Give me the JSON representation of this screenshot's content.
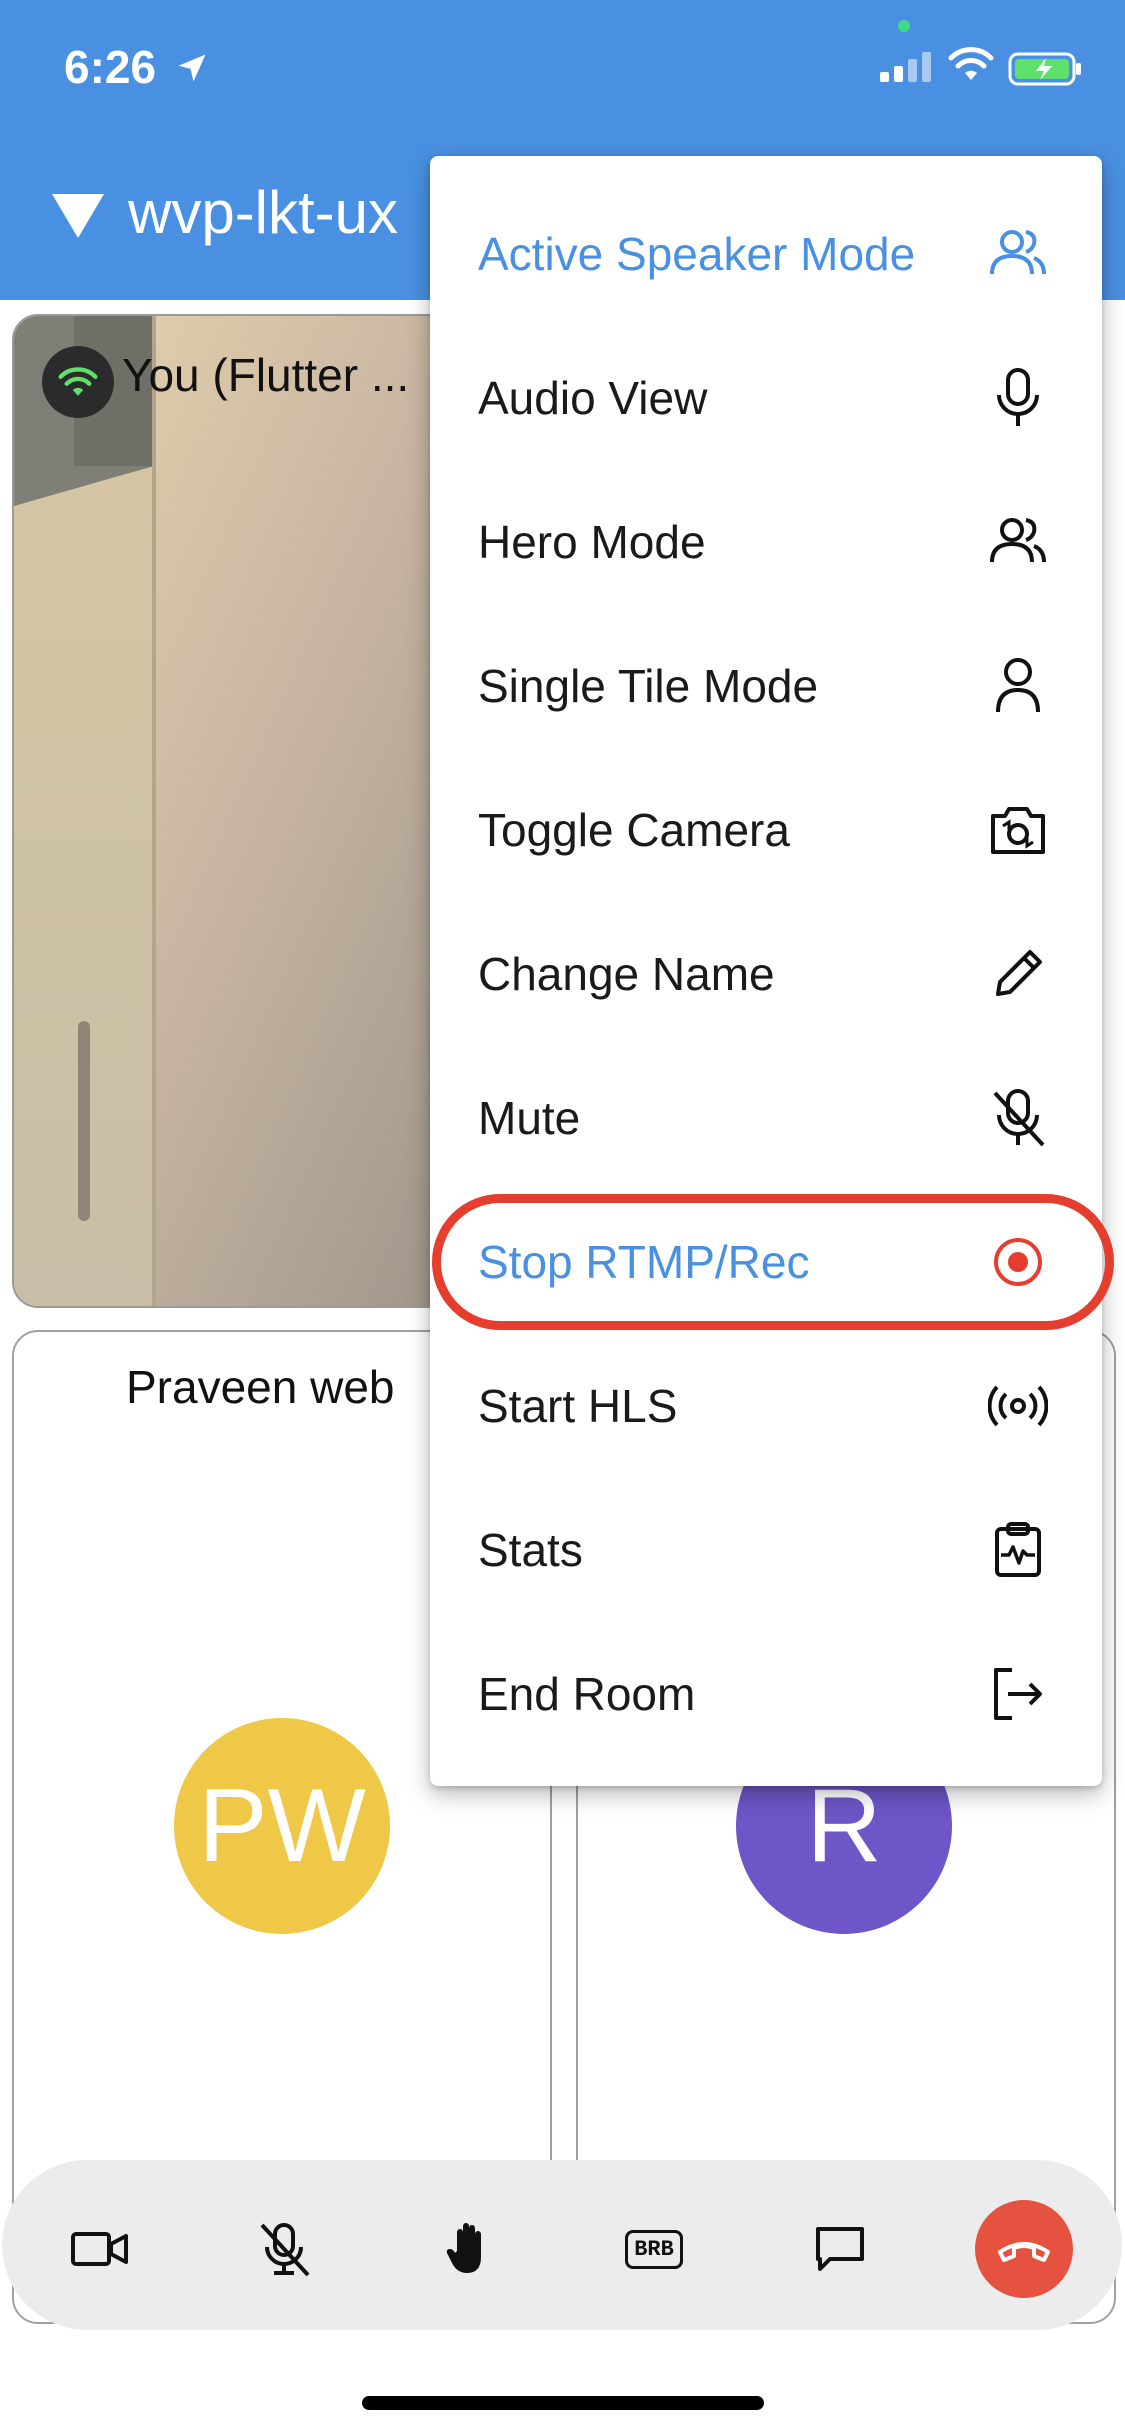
{
  "status_bar": {
    "time": "6:26"
  },
  "app_bar": {
    "room_title": "wvp-lkt-ux"
  },
  "tiles": {
    "self": {
      "name": "You (Flutter ..."
    },
    "peer_a": {
      "name": "Praveen web",
      "initials": "PW",
      "avatar_color": "#f0c847"
    },
    "peer_b": {
      "initials": "R",
      "avatar_color": "#6e55c8"
    }
  },
  "menu": {
    "items": [
      {
        "label": "Active Speaker Mode",
        "icon": "people-icon",
        "active": true
      },
      {
        "label": "Audio View",
        "icon": "microphone-icon"
      },
      {
        "label": "Hero Mode",
        "icon": "people-icon"
      },
      {
        "label": "Single Tile Mode",
        "icon": "person-icon"
      },
      {
        "label": "Toggle Camera",
        "icon": "camera-switch-icon"
      },
      {
        "label": "Change Name",
        "icon": "pencil-icon"
      },
      {
        "label": "Mute",
        "icon": "mic-off-icon"
      },
      {
        "label": "Stop RTMP/Rec",
        "icon": "record-icon",
        "highlighted": true
      },
      {
        "label": "Start HLS",
        "icon": "broadcast-icon"
      },
      {
        "label": "Stats",
        "icon": "stats-clipboard-icon"
      },
      {
        "label": "End Room",
        "icon": "exit-icon"
      }
    ]
  },
  "controls": {
    "brb_label": "BRB",
    "icons": [
      "video-camera-icon",
      "mic-off-icon",
      "raise-hand-icon",
      "brb-icon",
      "chat-icon",
      "end-call-icon"
    ]
  },
  "colors": {
    "app_bar": "#4a90e2",
    "accent": "#4a90e2",
    "highlight_ring": "#e53e2f",
    "end_call": "#e5523f"
  }
}
